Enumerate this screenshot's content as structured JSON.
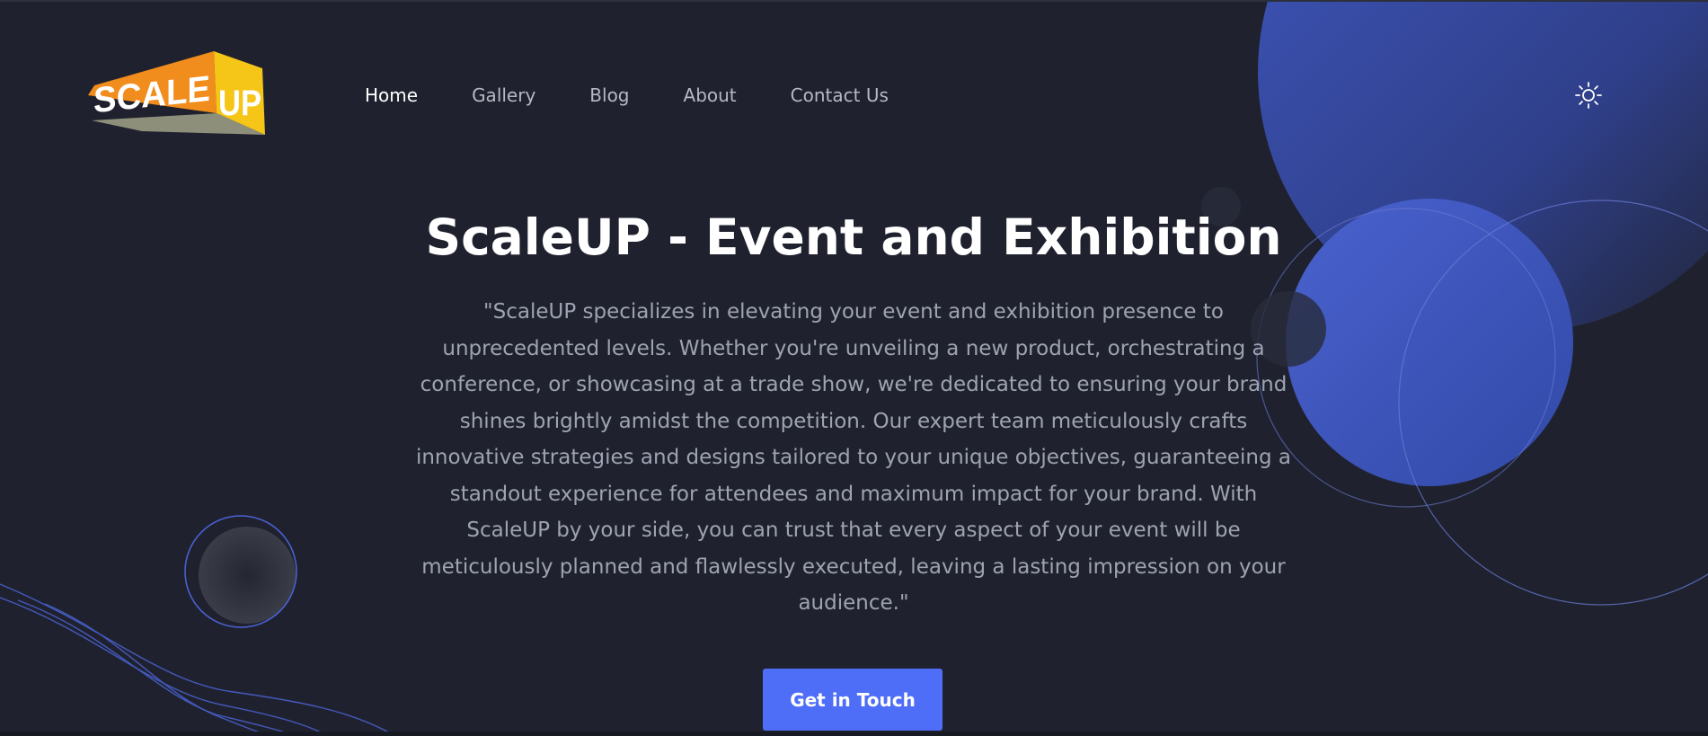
{
  "brand": {
    "logo_text_left": "SCALE",
    "logo_text_right": "UP"
  },
  "nav": {
    "items": [
      {
        "label": "Home",
        "active": true
      },
      {
        "label": "Gallery",
        "active": false
      },
      {
        "label": "Blog",
        "active": false
      },
      {
        "label": "About",
        "active": false
      },
      {
        "label": "Contact Us",
        "active": false
      }
    ]
  },
  "theme_toggle": {
    "icon": "sun-icon"
  },
  "hero": {
    "title": "ScaleUP - Event and Exhibition",
    "description_lines": [
      "\"ScaleUP specializes in elevating your event and exhibition presence to",
      "unprecedented levels. Whether you're unveiling a new product, orchestrating a",
      "conference, or showcasing at a trade show, we're dedicated to ensuring your brand",
      "shines brightly amidst the competition. Our expert team meticulously crafts",
      "innovative strategies and designs tailored to your unique objectives, guaranteeing a",
      "standout experience for attendees and maximum impact for your brand. With",
      "ScaleUP by your side, you can trust that every aspect of your event will be",
      "meticulously planned and flawlessly executed, leaving a lasting impression on your",
      "audience.\""
    ],
    "cta_label": "Get in Touch"
  },
  "colors": {
    "background": "#1f222e",
    "accent": "#4f6ef7",
    "title": "#ffffff",
    "body_text": "#9ea3b2",
    "nav_text": "#b6b9c3",
    "logo_orange": "#f18d1c",
    "logo_yellow": "#f5c518"
  }
}
